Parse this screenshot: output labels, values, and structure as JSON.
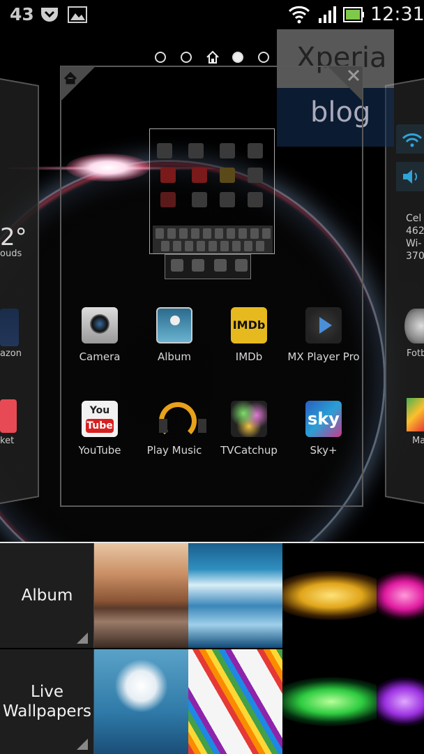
{
  "status_bar": {
    "notification_count": "43",
    "time": "12:31",
    "icons": [
      "pocket-icon",
      "gallery-icon",
      "wifi-icon",
      "signal-icon",
      "battery-icon"
    ]
  },
  "watermark": {
    "title": "Xperia",
    "subtitle": "blog"
  },
  "left_panel": {
    "temperature": "2°",
    "weather_text": "ouds",
    "app1_label": "azon",
    "app2_label": "ket"
  },
  "right_panel": {
    "cell_lines": [
      "Cel",
      "462",
      "Wi-",
      "370"
    ],
    "app1_label": "Fotb",
    "app2_label": "Ma"
  },
  "apps": [
    {
      "label": "Camera",
      "icon": "camera-icon"
    },
    {
      "label": "Album",
      "icon": "album-icon"
    },
    {
      "label": "IMDb",
      "icon": "imdb-icon",
      "icon_text": "IMDb"
    },
    {
      "label": "MX Player Pro",
      "icon": "mx-player-icon"
    },
    {
      "label": "YouTube",
      "icon": "youtube-icon",
      "icon_text_top": "You",
      "icon_text_bottom": "Tube"
    },
    {
      "label": "Play Music",
      "icon": "headphones-icon"
    },
    {
      "label": "TVCatchup",
      "icon": "tvcatchup-icon"
    },
    {
      "label": "Sky+",
      "icon": "sky-icon",
      "icon_text": "sky"
    }
  ],
  "picker": {
    "categories": [
      {
        "label": "Album"
      },
      {
        "label_line1": "Live",
        "label_line2": "Wallpapers"
      }
    ]
  },
  "colors": {
    "frame_border": "#5a5a5a",
    "picker_border": "#e8e8e8",
    "category_bg": "#1e1e1e"
  }
}
